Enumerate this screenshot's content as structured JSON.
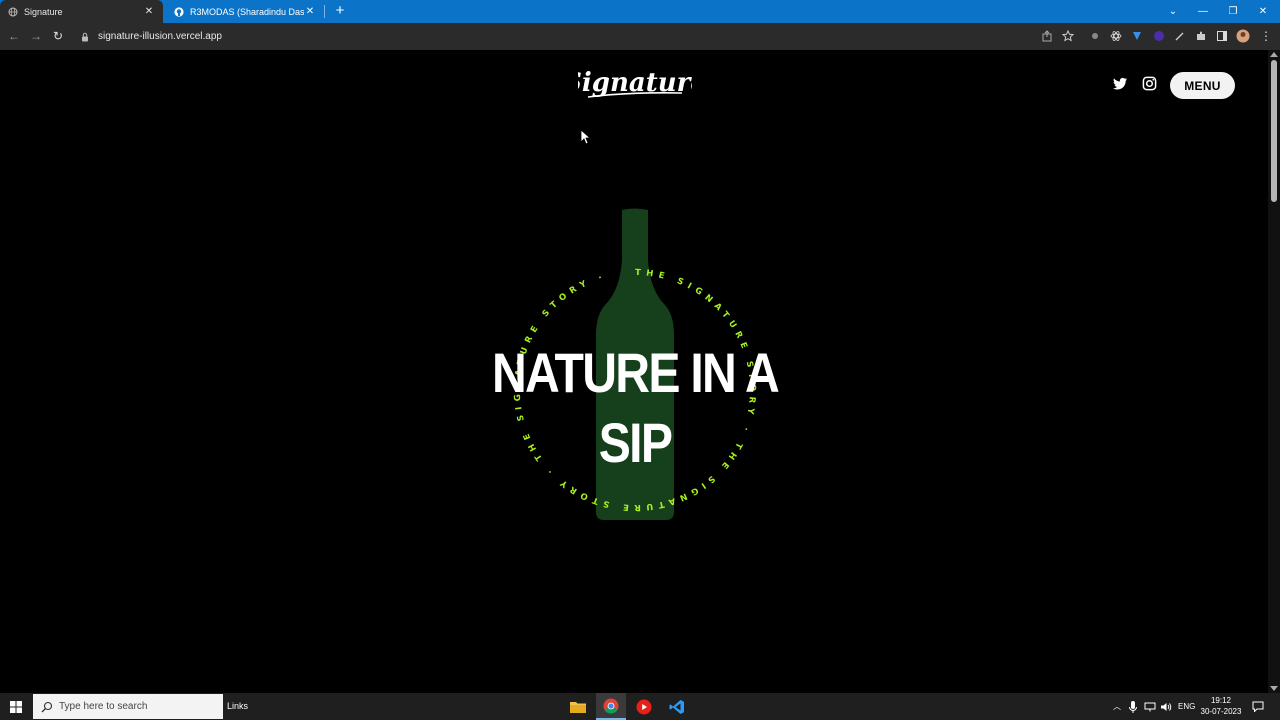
{
  "browser": {
    "tabs": [
      {
        "title": "Signature",
        "active": true
      },
      {
        "title": "R3MODAS (Sharadindu Das)",
        "active": false
      }
    ],
    "address": "signature-illusion.vercel.app"
  },
  "site": {
    "logo_text": "Signature",
    "menu_label": "MENU",
    "headline": "NATURE IN A SIP",
    "circle_text": "THE SIGNATURE STORY · THE SIGNATURE STORY · THE SIGNATURE STORY · ",
    "colors": {
      "background": "#000000",
      "bottle": "#163f1c",
      "circle_text": "#a6f020",
      "headline": "#ffffff"
    }
  },
  "taskbar": {
    "search_placeholder": "Type here to search",
    "links_label": "Links",
    "language": "ENG",
    "time": "19:12",
    "date": "30-07-2023"
  }
}
